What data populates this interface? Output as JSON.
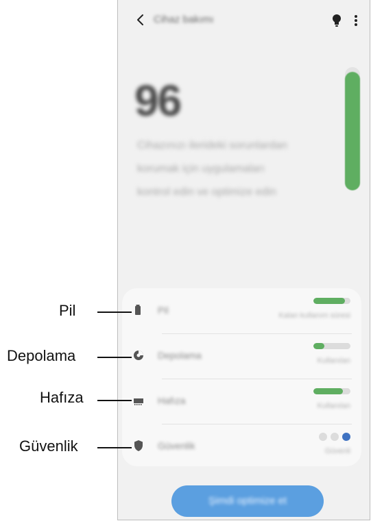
{
  "callouts": {
    "battery": "Pil",
    "storage": "Depolama",
    "memory": "Hafıza",
    "security": "Güvenlik"
  },
  "header": {
    "title": "Cihaz bakımı",
    "back_icon": "chevron-left-icon",
    "tip_icon": "lightbulb-icon",
    "more_icon": "more-vertical-icon"
  },
  "summary": {
    "score": "96",
    "description": "Cihazınızı ilerideki sorunlardan korumak için uygulamaları kontrol edin ve optimize edin",
    "score_level": 0.96
  },
  "items": [
    {
      "label": "Pil",
      "status": "Kalan kullanım süresi",
      "level": 0.85,
      "icon": "battery-icon"
    },
    {
      "label": "Depolama",
      "status": "Kullanılan",
      "level": 0.3,
      "icon": "pie-chart-icon"
    },
    {
      "label": "Hafıza",
      "status": "Kullanılan",
      "level": 0.8,
      "icon": "memory-chip-icon"
    },
    {
      "label": "Güvenlik",
      "status": "Güvenli",
      "icon": "shield-icon",
      "dots_active": 3
    }
  ],
  "cta": {
    "label": "Şimdi optimize et"
  },
  "colors": {
    "accent_green": "#5fae61",
    "accent_blue": "#3f72c1",
    "button_blue": "#5b9fe0"
  }
}
